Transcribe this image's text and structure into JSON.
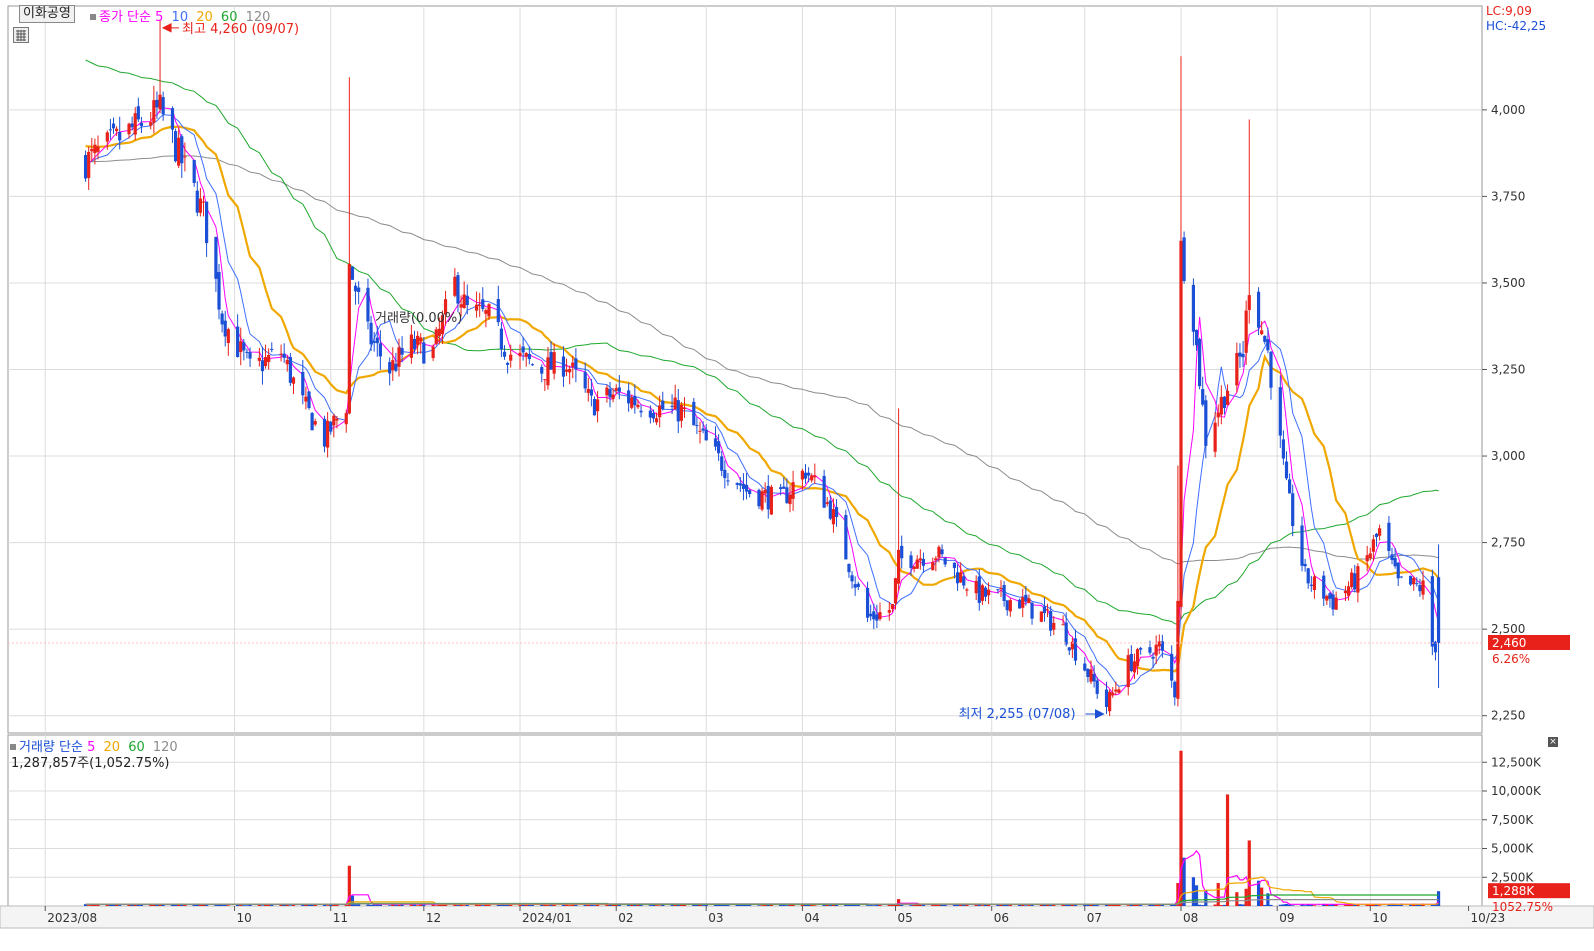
{
  "stock_name": "이화공영",
  "price_legend": {
    "label": "종가 단순",
    "periods": [
      "5",
      "10",
      "20",
      "60",
      "120"
    ]
  },
  "volume_legend": {
    "label": "거래량 단순",
    "periods": [
      "5",
      "20",
      "60",
      "120"
    ]
  },
  "volume_info": "1,287,857주(1,052.75%)",
  "high_marker": "최고 4,260 (09/07)",
  "low_marker": "최저 2,255 (07/08)",
  "lc_label": "LC:9,09",
  "hc_label": "HC:-42,25",
  "current_price_tag": "2,460",
  "current_change_pct": "6.26%",
  "current_volume_tag": "1,288K",
  "current_volume_pct": "1052.75%",
  "overlay_text": "거래량(0.00%)",
  "colors": {
    "up": "#e8211a",
    "down": "#1a4fd6",
    "ma5": "#ff00ff",
    "ma10": "#3f6fff",
    "ma20": "#f0a800",
    "ma60": "#1fa82e",
    "ma120": "#8c8c8c",
    "grid": "#dcdcdc"
  },
  "chart_data": [
    {
      "type": "candlestick",
      "title": "",
      "ylim": [
        2200,
        4300
      ],
      "y_ticks": [
        "2,250",
        "2,500",
        "2,750",
        "3,000",
        "3,250",
        "3,500",
        "3,750",
        "4,000"
      ],
      "x_ticks": [
        "2023/08",
        "10",
        "11",
        "12",
        "2024/01",
        "02",
        "03",
        "04",
        "05",
        "06",
        "07",
        "08",
        "09",
        "10",
        "10/23"
      ],
      "ma_periods": [
        5,
        10,
        20,
        60,
        120
      ],
      "anchors": [
        [
          "2023/08/14",
          3850
        ],
        [
          "2023/09/07",
          4000
        ],
        [
          "2023/09/14",
          3850
        ],
        [
          "2023/09/21",
          3700
        ],
        [
          "2023/09/27",
          3400
        ],
        [
          "2023/10/06",
          3250
        ],
        [
          "2023/10/16",
          3300
        ],
        [
          "2023/10/23",
          3150
        ],
        [
          "2023/10/30",
          3050
        ],
        [
          "2023/11/06",
          3150
        ],
        [
          "2023/11/07",
          3550
        ],
        [
          "2023/11/13",
          3350
        ],
        [
          "2023/11/20",
          3250
        ],
        [
          "2023/11/27",
          3320
        ],
        [
          "2023/12/04",
          3300
        ],
        [
          "2023/12/11",
          3500
        ],
        [
          "2023/12/15",
          3420
        ],
        [
          "2023/12/22",
          3400
        ],
        [
          "2023/12/28",
          3300
        ],
        [
          "2024/01/08",
          3250
        ],
        [
          "2024/01/16",
          3270
        ],
        [
          "2024/01/24",
          3150
        ],
        [
          "2024/02/01",
          3180
        ],
        [
          "2024/02/13",
          3140
        ],
        [
          "2024/02/22",
          3130
        ],
        [
          "2024/03/04",
          3000
        ],
        [
          "2024/03/14",
          2900
        ],
        [
          "2024/03/25",
          2870
        ],
        [
          "2024/04/02",
          2960
        ],
        [
          "2024/04/10",
          2850
        ],
        [
          "2024/04/22",
          2530
        ],
        [
          "2024/04/30",
          2560
        ],
        [
          "2024/05/02",
          2700
        ],
        [
          "2024/05/14",
          2720
        ],
        [
          "2024/05/28",
          2600
        ],
        [
          "2024/06/10",
          2580
        ],
        [
          "2024/06/24",
          2500
        ],
        [
          "2024/07/08",
          2280
        ],
        [
          "2024/07/15",
          2400
        ],
        [
          "2024/07/25",
          2450
        ],
        [
          "2024/07/30",
          2320
        ],
        [
          "2024/07/31",
          2600
        ],
        [
          "2024/08/01",
          3600
        ],
        [
          "2024/08/05",
          3400
        ],
        [
          "2024/08/09",
          3050
        ],
        [
          "2024/08/16",
          3200
        ],
        [
          "2024/08/21",
          3300
        ],
        [
          "2024/08/23",
          3500
        ],
        [
          "2024/08/29",
          3300
        ],
        [
          "2024/09/04",
          2900
        ],
        [
          "2024/09/10",
          2650
        ],
        [
          "2024/09/19",
          2580
        ],
        [
          "2024/09/27",
          2650
        ],
        [
          "2024/10/04",
          2780
        ],
        [
          "2024/10/10",
          2630
        ],
        [
          "2024/10/18",
          2620
        ],
        [
          "2024/10/21",
          2450
        ],
        [
          "2024/10/23",
          2460
        ]
      ],
      "annotations": {
        "high": {
          "date": "2023/09/07",
          "value": 4260
        },
        "low": {
          "date": "2024/07/08",
          "value": 2255
        },
        "last": {
          "date": "2024/10/23",
          "value": 2460
        }
      }
    },
    {
      "type": "bar",
      "title": "",
      "ylim": [
        0,
        14000
      ],
      "unit": "K",
      "y_ticks": [
        "2,500K",
        "5,000K",
        "7,500K",
        "10,000K",
        "12,500K"
      ],
      "spikes": [
        [
          "2023/11/07",
          3500
        ],
        [
          "2023/11/08",
          900
        ],
        [
          "2024/05/02",
          600
        ],
        [
          "2024/07/31",
          2000
        ],
        [
          "2024/08/01",
          13500
        ],
        [
          "2024/08/02",
          4200
        ],
        [
          "2024/08/05",
          2500
        ],
        [
          "2024/08/06",
          1800
        ],
        [
          "2024/08/09",
          1400
        ],
        [
          "2024/08/13",
          2000
        ],
        [
          "2024/08/16",
          9700
        ],
        [
          "2024/08/19",
          1200
        ],
        [
          "2024/08/22",
          1500
        ],
        [
          "2024/08/23",
          5700
        ],
        [
          "2024/08/26",
          2200
        ],
        [
          "2024/08/27",
          1600
        ],
        [
          "2024/08/29",
          1100
        ],
        [
          "2024/10/23",
          1288
        ]
      ],
      "base_volume": 150,
      "last": {
        "date": "2024/10/23",
        "value": 1288
      }
    }
  ]
}
